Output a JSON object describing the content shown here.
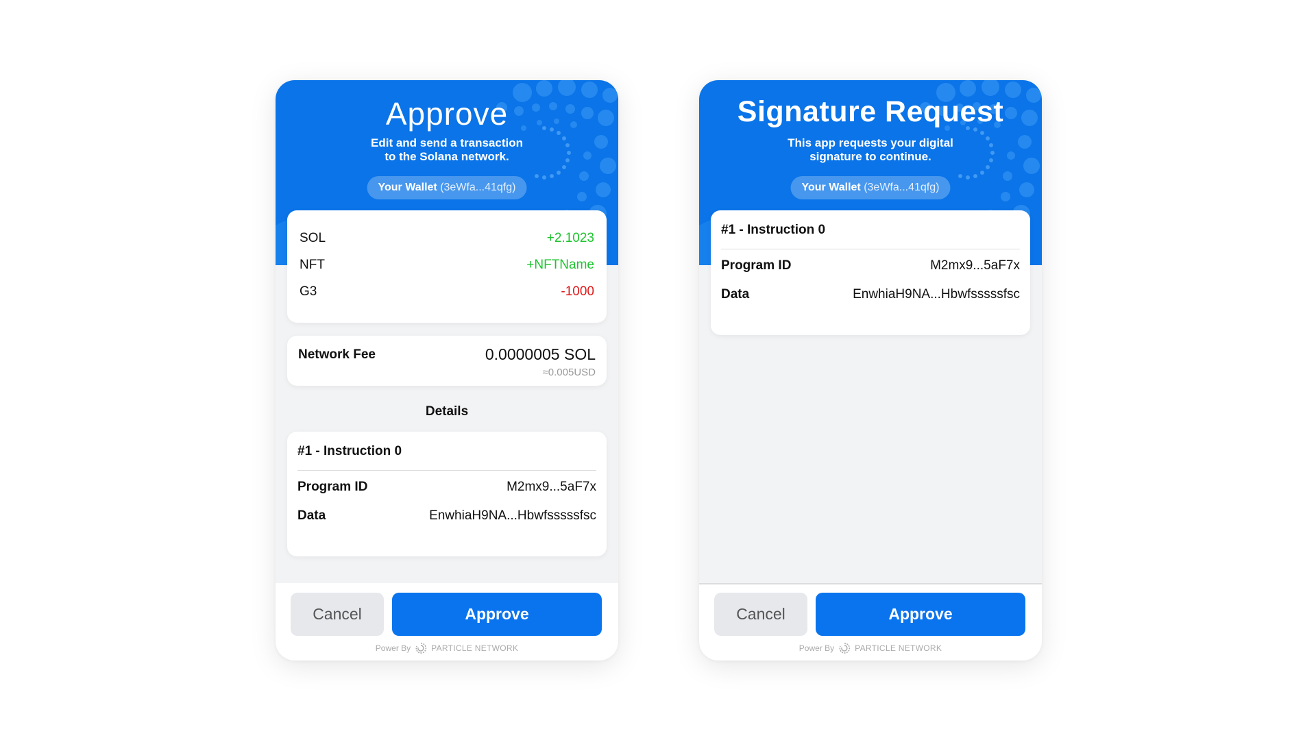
{
  "colors": {
    "brand_blue": "#0a74e8",
    "approve_button": "#0a74ee",
    "positive": "#1dc42e",
    "negative": "#e01a1a"
  },
  "approve_card": {
    "title": "Approve",
    "subtitle_line1": "Edit and send a transaction",
    "subtitle_line2": "to the Solana network.",
    "wallet_label": "Your Wallet",
    "wallet_address": "(3eWfa...41qfg)",
    "balance_changes": [
      {
        "asset": "SOL",
        "change": "+2.1023",
        "tone": "positive"
      },
      {
        "asset": "NFT",
        "change": "+NFTName",
        "tone": "positive"
      },
      {
        "asset": "G3",
        "change": "-1000",
        "tone": "negative"
      }
    ],
    "network_fee": {
      "label": "Network Fee",
      "value": "0.0000005 SOL",
      "usd": "≈0.005USD"
    },
    "details_title": "Details",
    "instruction": {
      "title": "#1 - Instruction 0",
      "program_id_label": "Program ID",
      "program_id_value": "M2mx9...5aF7x",
      "data_label": "Data",
      "data_value": "EnwhiaH9NA...Hbwfsssssfsc"
    },
    "cancel_label": "Cancel",
    "approve_label": "Approve",
    "powered_by": "Power By",
    "powered_brand": "PARTICLE NETWORK"
  },
  "signature_card": {
    "title": "Signature Request",
    "subtitle_line1": "This app requests your digital",
    "subtitle_line2": "signature to continue.",
    "wallet_label": "Your Wallet",
    "wallet_address": "(3eWfa...41qfg)",
    "instruction": {
      "title": "#1 - Instruction 0",
      "program_id_label": "Program ID",
      "program_id_value": "M2mx9...5aF7x",
      "data_label": "Data",
      "data_value": "EnwhiaH9NA...Hbwfsssssfsc"
    },
    "cancel_label": "Cancel",
    "approve_label": "Approve",
    "powered_by": "Power By",
    "powered_brand": "PARTICLE NETWORK"
  }
}
